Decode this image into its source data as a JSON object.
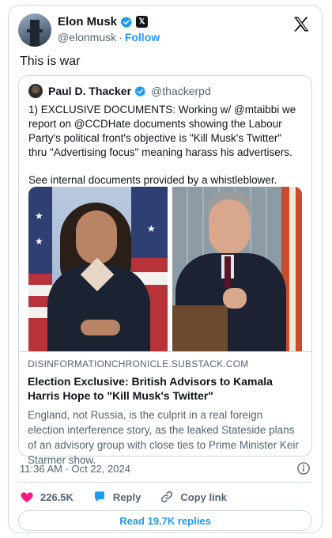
{
  "author": {
    "name": "Elon Musk",
    "handle": "@elonmusk",
    "separator": "·",
    "follow_label": "Follow"
  },
  "tweet_text": "This is war",
  "quoted": {
    "name": "Paul D. Thacker",
    "handle": "@thackerpd",
    "paragraph1": "1) EXCLUSIVE DOCUMENTS: Working w/ @mtaibbi we report on @CCDHate documents showing the Labour Party's political front's objective is \"Kill Musk's Twitter\" thru \"Advertising focus\" meaning harass his advertisers.",
    "paragraph2": "See internal documents provided by a whistleblower.",
    "link_domain": "DISINFORMATIONCHRONICLE.SUBSTACK.COM",
    "link_title": "Election Exclusive: British Advisors to Kamala Harris Hope to \"Kill Musk's Twitter\"",
    "link_description": "England, not Russia, is the culprit in a real foreign election interference story, as the leaked Stateside plans of an advisory group with close ties to Prime Minister Keir Starmer show."
  },
  "timestamp": "11:36 AM · Oct 22, 2024",
  "actions": {
    "likes": "226.5K",
    "reply_label": "Reply",
    "copy_label": "Copy link"
  },
  "read_replies_label": "Read 19.7K replies",
  "colors": {
    "accent": "#1d9bf0",
    "like": "#f91880",
    "text": "#0f1419",
    "muted": "#536471",
    "border": "#cfd9de"
  }
}
